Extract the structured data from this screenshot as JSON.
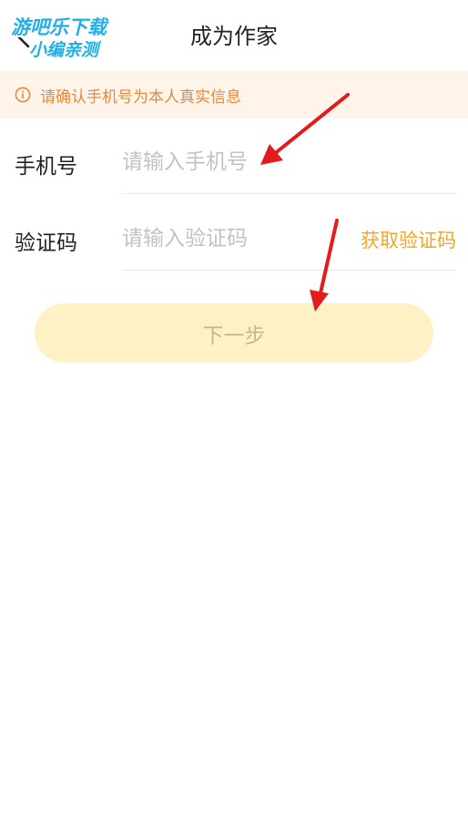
{
  "header": {
    "title": "成为作家"
  },
  "watermark": {
    "line1": "游吧乐下载",
    "line2": "小编亲测"
  },
  "notice": {
    "text": "请确认手机号为本人真实信息"
  },
  "form": {
    "phone": {
      "label": "手机号",
      "placeholder": "请输入手机号",
      "value": ""
    },
    "code": {
      "label": "验证码",
      "placeholder": "请输入验证码",
      "value": "",
      "get_code_label": "获取验证码"
    }
  },
  "next_button": {
    "label": "下一步"
  },
  "colors": {
    "accent": "#f5a623",
    "notice_bg": "#fff4ea",
    "notice_text": "#e8893e",
    "button_bg_disabled": "#fff1c6",
    "annotation_arrow": "#e31b1b"
  },
  "icons": {
    "back": "chevron-left-icon",
    "info": "info-circle-icon"
  }
}
